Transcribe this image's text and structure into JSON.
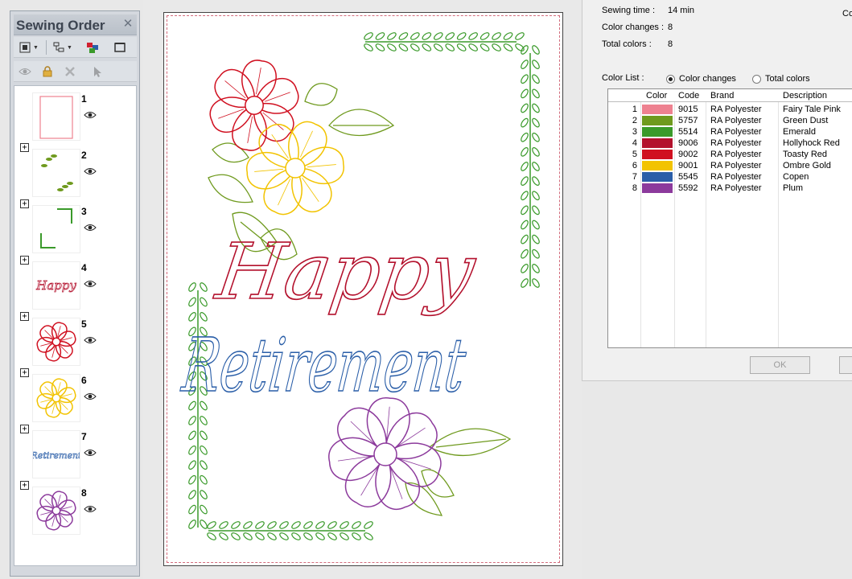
{
  "panel": {
    "title": "Sewing Order",
    "items": [
      {
        "number": "1",
        "expandable": false
      },
      {
        "number": "2",
        "expandable": true
      },
      {
        "number": "3",
        "expandable": true
      },
      {
        "number": "4",
        "expandable": true
      },
      {
        "number": "5",
        "expandable": true
      },
      {
        "number": "6",
        "expandable": true
      },
      {
        "number": "7",
        "expandable": true
      },
      {
        "number": "8",
        "expandable": true
      }
    ]
  },
  "design": {
    "word1": "Happy",
    "word2": "Retirement"
  },
  "info": {
    "sewing_time_label": "Sewing time :",
    "sewing_time_value": "14 min",
    "color_changes_label": "Color changes :",
    "color_changes_value": "8",
    "total_colors_label": "Total colors :",
    "total_colors_value": "8",
    "truncated_label": "Co",
    "color_list_label": "Color List :",
    "radio_color_changes": "Color changes",
    "radio_total_colors": "Total colors",
    "radio_selected": "color_changes"
  },
  "grid": {
    "headers": {
      "color": "Color",
      "code": "Code",
      "brand": "Brand",
      "description": "Description"
    },
    "rows": [
      {
        "index": "1",
        "hex": "#ee8190",
        "code": "9015",
        "brand": "RA Polyester",
        "description": "Fairy Tale Pink"
      },
      {
        "index": "2",
        "hex": "#6f9a1e",
        "code": "5757",
        "brand": "RA Polyester",
        "description": "Green Dust"
      },
      {
        "index": "3",
        "hex": "#3a9a2a",
        "code": "5514",
        "brand": "RA Polyester",
        "description": "Emerald"
      },
      {
        "index": "4",
        "hex": "#b3102c",
        "code": "9006",
        "brand": "RA Polyester",
        "description": "Hollyhock Red"
      },
      {
        "index": "5",
        "hex": "#d01020",
        "code": "9002",
        "brand": "RA Polyester",
        "description": "Toasty Red"
      },
      {
        "index": "6",
        "hex": "#f2c300",
        "code": "9001",
        "brand": "RA Polyester",
        "description": "Ombre Gold"
      },
      {
        "index": "7",
        "hex": "#2a5ea8",
        "code": "5545",
        "brand": "RA Polyester",
        "description": "Copen"
      },
      {
        "index": "8",
        "hex": "#8c3a9c",
        "code": "5592",
        "brand": "RA Polyester",
        "description": "Plum"
      }
    ]
  },
  "buttons": {
    "ok": "OK"
  },
  "icons": [
    "fit-view-icon",
    "group-icon",
    "color-sort-icon",
    "frame-icon",
    "visibility-icon",
    "lock-icon",
    "delete-icon",
    "select-pointer-icon",
    "close-icon",
    "eye-icon",
    "expand-icon"
  ]
}
